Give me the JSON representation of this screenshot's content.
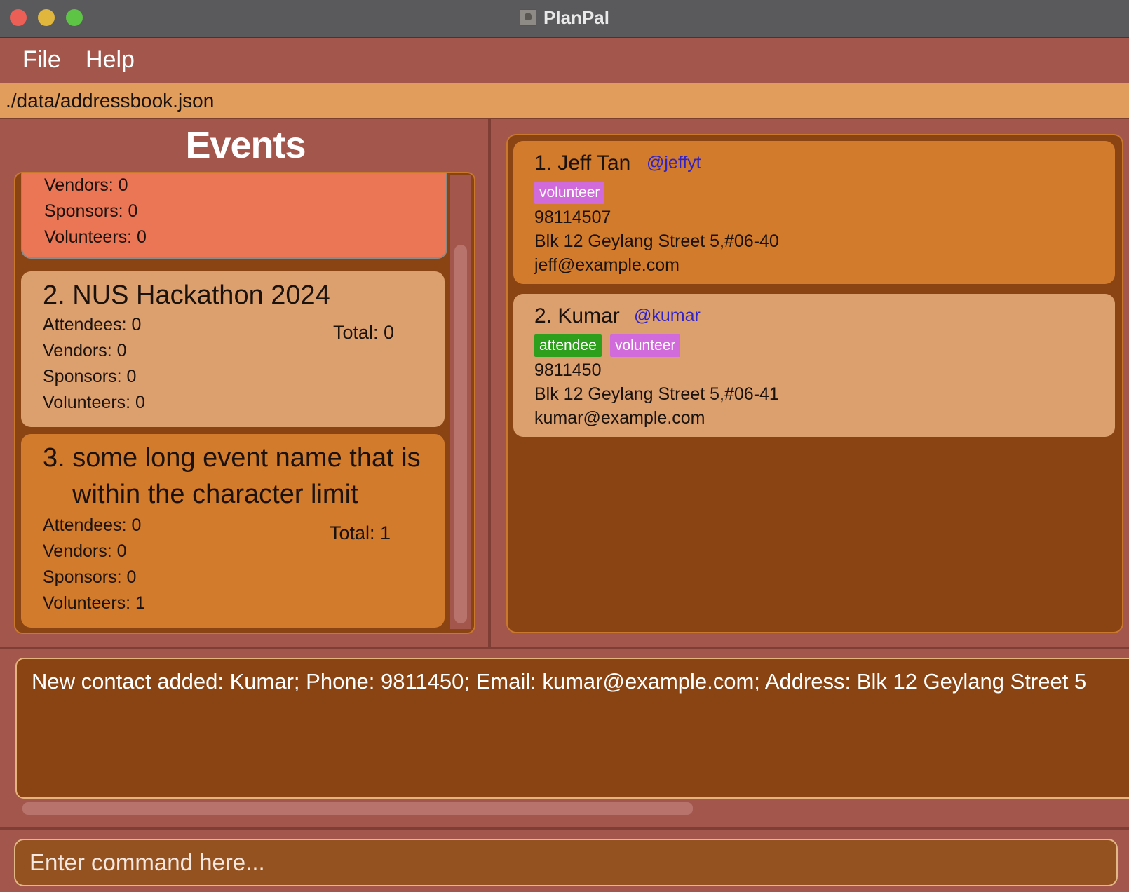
{
  "window": {
    "title": "PlanPal"
  },
  "menu": {
    "file": "File",
    "help": "Help"
  },
  "path_bar": {
    "path": "./data/addressbook.json"
  },
  "events": {
    "heading": "Events",
    "items": [
      {
        "vendors": "Vendors: 0",
        "sponsors": "Sponsors: 0",
        "volunteers": "Volunteers: 0"
      },
      {
        "title": "2. NUS Hackathon 2024",
        "attendees": "Attendees: 0",
        "vendors": "Vendors: 0",
        "sponsors": "Sponsors: 0",
        "volunteers": "Volunteers: 0",
        "total": "Total: 0"
      },
      {
        "title_line1": "3. some long event name that is",
        "title_line2": "within the character limit",
        "attendees": "Attendees: 0",
        "vendors": "Vendors: 0",
        "sponsors": "Sponsors: 0",
        "volunteers": "Volunteers: 1",
        "total": "Total: 1"
      }
    ]
  },
  "contacts": {
    "items": [
      {
        "name": "1. Jeff Tan",
        "handle": "@jeffyt",
        "tags": [
          "volunteer"
        ],
        "phone": "98114507",
        "address": "Blk 12 Geylang Street 5,#06-40",
        "email": "jeff@example.com"
      },
      {
        "name": "2. Kumar",
        "handle": "@kumar",
        "tags": [
          "attendee",
          "volunteer"
        ],
        "phone": "9811450",
        "address": "Blk 12 Geylang Street 5,#06-41",
        "email": "kumar@example.com"
      }
    ]
  },
  "result": {
    "text": "New contact added: Kumar; Phone: 9811450; Email: kumar@example.com; Address: Blk 12 Geylang Street 5"
  },
  "command": {
    "placeholder": "Enter command here..."
  },
  "colors": {
    "background": "#a3574c",
    "path_bar": "#e09d5c",
    "list_bg": "#8a4312",
    "event_selected": "#eb7655",
    "event_light": "#dca06f",
    "event_orange": "#d27b2c",
    "tag_volunteer": "#d16bdb",
    "tag_attendee": "#2e9f1c",
    "handle": "#2f22c8"
  }
}
